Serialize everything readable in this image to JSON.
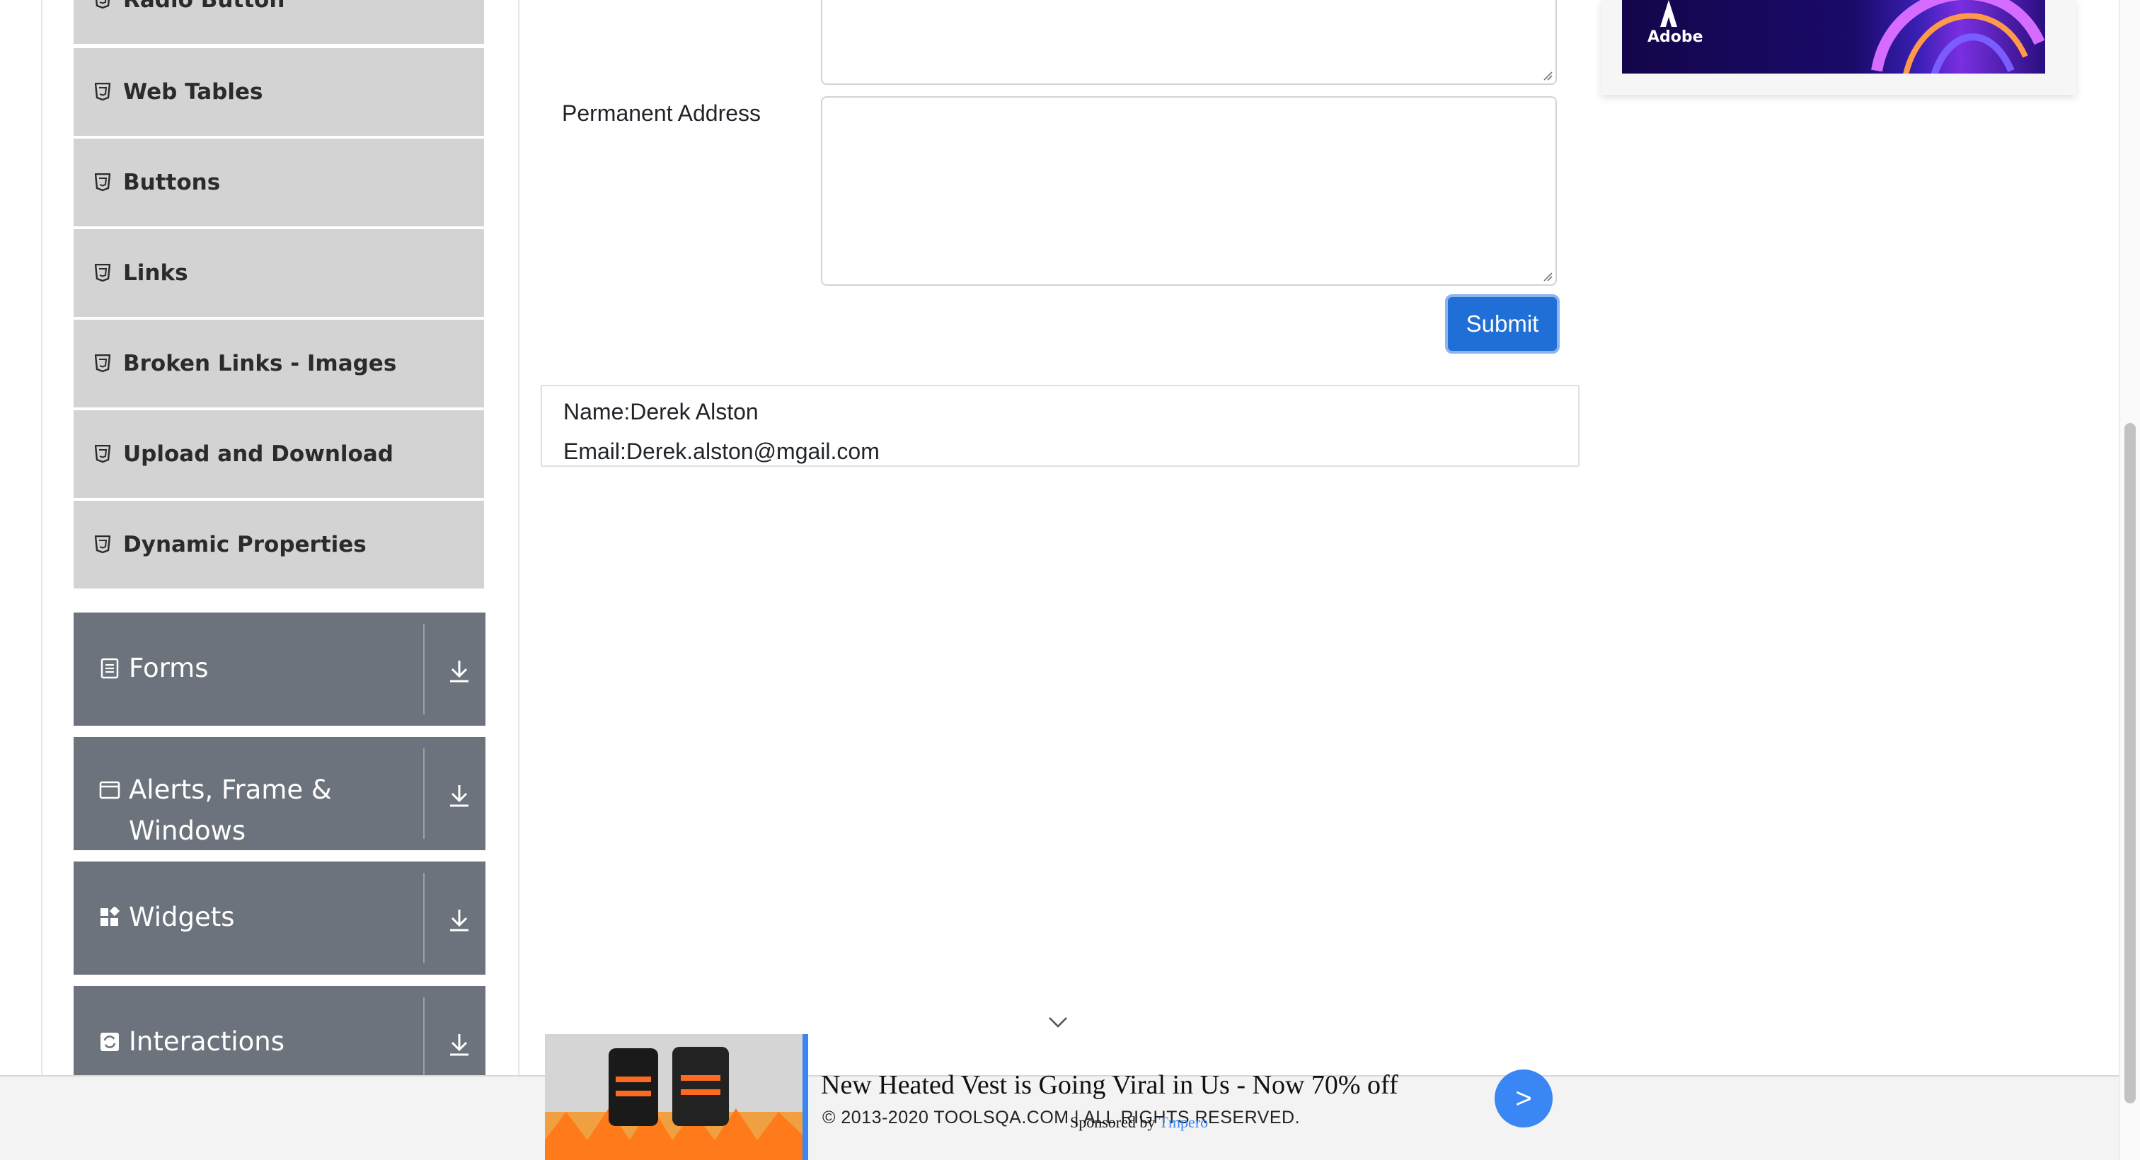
{
  "sidebar": {
    "elements_items": [
      {
        "label": "Radio Button"
      },
      {
        "label": "Web Tables"
      },
      {
        "label": "Buttons"
      },
      {
        "label": "Links"
      },
      {
        "label": "Broken Links - Images"
      },
      {
        "label": "Upload and Download"
      },
      {
        "label": "Dynamic Properties"
      }
    ],
    "groups": [
      {
        "label": "Forms",
        "icon": "form-icon"
      },
      {
        "label_line1": "Alerts, Frame &",
        "label_line2": "Windows",
        "icon": "window-icon"
      },
      {
        "label": "Widgets",
        "icon": "widgets-icon"
      },
      {
        "label": "Interactions",
        "icon": "interactions-icon"
      }
    ]
  },
  "form": {
    "permanent_address_label": "Permanent Address",
    "submit_label": "Submit"
  },
  "output": {
    "name": "Name:Derek Alston",
    "email": "Email:Derek.alston@mgail.com"
  },
  "right_ad": {
    "brand": "Adobe"
  },
  "bottom_ad": {
    "headline": "New Heated Vest is Going Viral in Us - Now 70% off",
    "go_label": ">",
    "sponsored_prefix": "Sponsored by",
    "sponsor_name": "Tmpero"
  },
  "footer": {
    "copyright": "© 2013-2020 TOOLSQA.COM | ALL RIGHTS RESERVED."
  },
  "colors": {
    "sidebar_item_bg": "#d3d3d3",
    "group_header_bg": "#6c737c",
    "submit_bg": "#1f6fd6",
    "ad_accent": "#3a86f4"
  }
}
